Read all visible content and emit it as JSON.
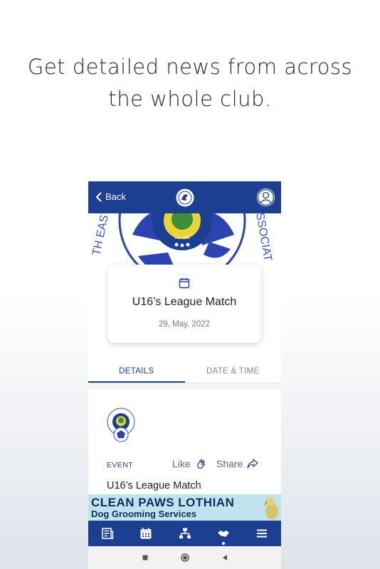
{
  "headline": {
    "line1": "Get detailed news from across",
    "line2": "the whole club."
  },
  "appbar": {
    "back_label": "Back",
    "logo_icon": "club-crest-icon",
    "profile_icon": "user-profile-icon"
  },
  "event_card": {
    "icon": "calendar-icon",
    "title": "U16’s League Match",
    "date": "29, May. 2022"
  },
  "tabs": [
    {
      "label": "DETAILS",
      "active": true
    },
    {
      "label": "DATE & TIME",
      "active": false
    }
  ],
  "detail": {
    "category": "EVENT",
    "like_label": "Like",
    "share_label": "Share",
    "title": "U16’s League Match"
  },
  "ad_banner": {
    "line1": "CLEAN PAWS LOTHIAN",
    "line2": "Dog Grooming Services"
  },
  "bottom_nav": [
    {
      "icon": "news-icon"
    },
    {
      "icon": "calendar-icon"
    },
    {
      "icon": "trophy-icon"
    },
    {
      "icon": "handshake-icon",
      "active": true
    },
    {
      "icon": "menu-icon"
    }
  ],
  "colors": {
    "primary": "#1d3f91",
    "banner_bg": "#bfe4ee"
  }
}
